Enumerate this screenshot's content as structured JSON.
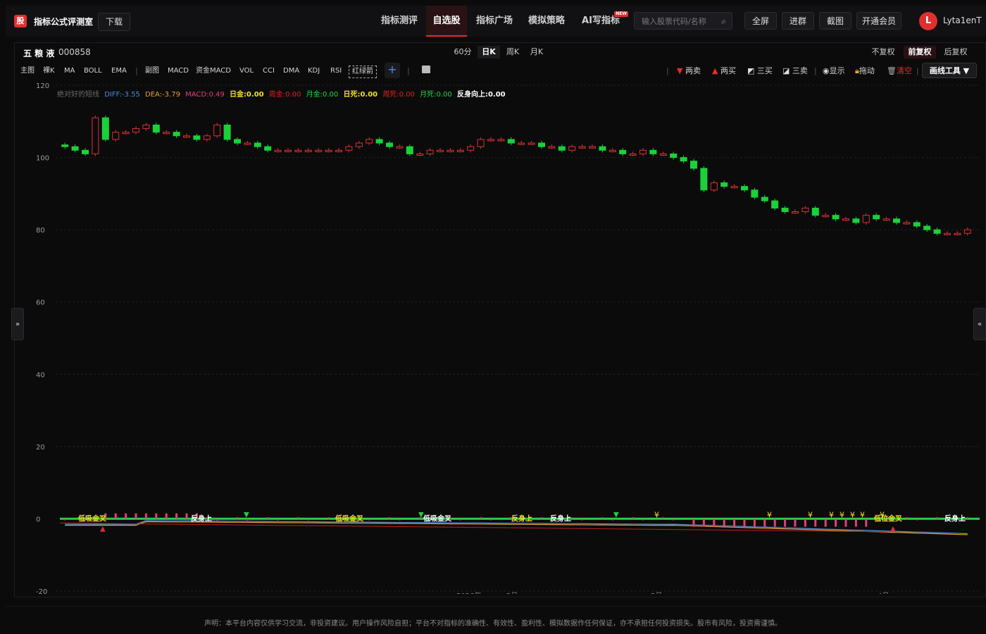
{
  "header": {
    "logo_text": "股",
    "brand": "指标公式评测室",
    "download": "下载",
    "nav": [
      "指标测评",
      "自选股",
      "指标广场",
      "模拟策略",
      "AI写指标"
    ],
    "nav_active": "自选股",
    "new_badge": "NEW",
    "search_placeholder": "输入股票代码/名称",
    "fullscreen": "全屏",
    "join_group": "进群",
    "screenshot": "截图",
    "vip": "开通会员",
    "avatar": "L",
    "username": "Lyta1enT"
  },
  "stock": {
    "name": "五 粮 液",
    "code": "000858"
  },
  "periods": [
    "60分",
    "日K",
    "周K",
    "月K"
  ],
  "period_active": "日K",
  "adjustments": [
    "不复权",
    "前复权",
    "后复权"
  ],
  "adjust_active": "前复权",
  "indicators": [
    "主图",
    "裸K",
    "MA",
    "BOLL",
    "EMA",
    "副图",
    "MACD",
    "资金MACD",
    "VOL",
    "CCI",
    "DMA",
    "KDJ",
    "RSI",
    "红绿箭"
  ],
  "tools": {
    "sell2": "两卖",
    "buy2": "两买",
    "buy3": "三买",
    "sell3": "三卖",
    "show": "显示",
    "drag": "拖动",
    "clear": "清空",
    "draw": "画线工具 ▼"
  },
  "legend": [
    {
      "text": "绝对好的短线",
      "color": "#6b6b6b"
    },
    {
      "text": "DIFF:-3.55",
      "color": "#4a8cd8"
    },
    {
      "text": "DEA:-3.79",
      "color": "#e8a030"
    },
    {
      "text": "MACD:0.49",
      "color": "#e0407a"
    },
    {
      "text": "日金:0.00",
      "color": "#f0e020"
    },
    {
      "text": "周金:0.00",
      "color": "#e02020"
    },
    {
      "text": "月金:0.00",
      "color": "#22d040"
    },
    {
      "text": "日死:0.00",
      "color": "#f0e020"
    },
    {
      "text": "周死:0.00",
      "color": "#e02020"
    },
    {
      "text": "月死:0.00",
      "color": "#22d040"
    },
    {
      "text": "反身向上:0.00",
      "color": "#ffffff"
    }
  ],
  "chart_data": {
    "type": "candlestick",
    "ylim": [
      -20,
      120
    ],
    "yticks": [
      120,
      100,
      80,
      60,
      40,
      20,
      0,
      -20
    ],
    "xticks": [
      "2026年",
      "2月",
      "3月",
      "4月"
    ],
    "candles_close": [
      103,
      102,
      101,
      111,
      105,
      107,
      107,
      108,
      109,
      107,
      107,
      106,
      106,
      105,
      106,
      109,
      105,
      104,
      104,
      103,
      102,
      102,
      102,
      102,
      102,
      102,
      102,
      102,
      103,
      104,
      105,
      104,
      103,
      103,
      101,
      101,
      102,
      102,
      102,
      102,
      103,
      105,
      105,
      105,
      104,
      104,
      104,
      103,
      103,
      102,
      103,
      103,
      103,
      102,
      102,
      101,
      101,
      102,
      101,
      101,
      100,
      99,
      97,
      91,
      93,
      92,
      92,
      91,
      89,
      88,
      86,
      85,
      85,
      86,
      84,
      84,
      83,
      83,
      82,
      84,
      83,
      83,
      82,
      82,
      81,
      80,
      79,
      79,
      79,
      80
    ],
    "up_color": "#e0302f",
    "down_color": "#1bd13a",
    "signal_labels": [
      "低吸金叉",
      "反身上",
      "低吸金叉",
      "低吸金叉",
      "反身上",
      "反身上",
      "低位金叉",
      "反身上"
    ],
    "diff_end": -3.55,
    "dea_end": -3.79,
    "macd_end": 0.49
  },
  "sidebar": {
    "left_toggle": "»",
    "right_toggle": "«"
  },
  "footer": {
    "disclaimer": "声明：本平台内容仅供学习交流，非投资建议。用户操作风险自担；平台不对指标的准确性、有效性、盈利性、模拟数据作任何保证，亦不承担任何投资损失。股市有风险，投资需谨慎。"
  }
}
